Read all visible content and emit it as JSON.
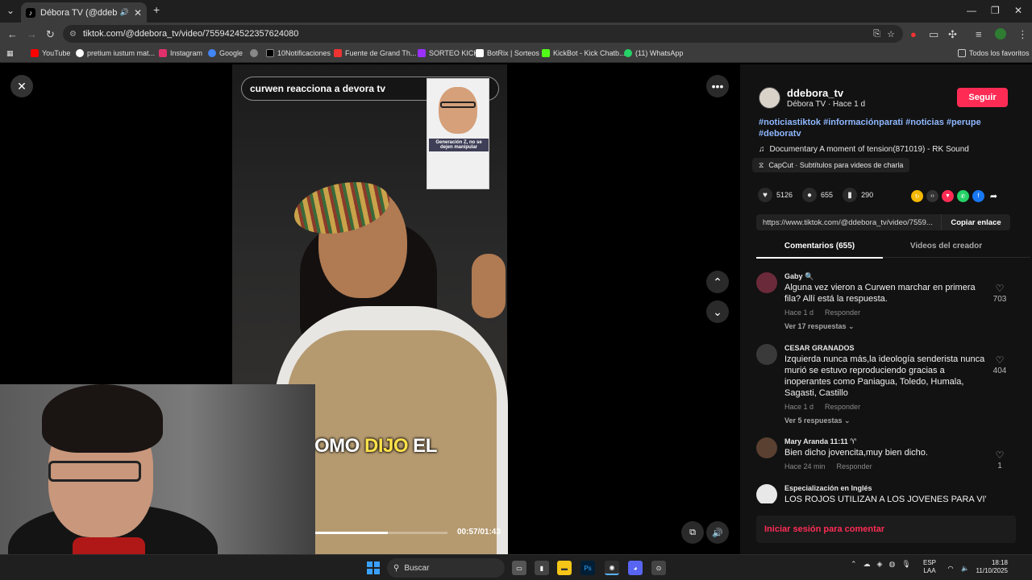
{
  "browser": {
    "tab_title": "Débora TV (@ddebora_tv) |",
    "url": "tiktok.com/@ddebora_tv/video/7559424522357624080",
    "bookmarks": [
      {
        "label": "YouTube",
        "color": "#ff0000"
      },
      {
        "label": "pretium iustum mat...",
        "color": "#ffffff"
      },
      {
        "label": "Instagram",
        "color": "#e1306c"
      },
      {
        "label": "Google",
        "color": "#4285f4"
      },
      {
        "label": "",
        "color": "#888888"
      },
      {
        "label": "10Notificaciones",
        "color": "#000000"
      },
      {
        "label": "Fuente de Grand Th...",
        "color": "#e33"
      },
      {
        "label": "SORTEO KICK",
        "color": "#9b30ff"
      },
      {
        "label": "BotRix | Sorteos",
        "color": "#ffffff"
      },
      {
        "label": "KickBot - Kick Chatb...",
        "color": "#53fc18"
      },
      {
        "label": "(11) WhatsApp",
        "color": "#25d366"
      }
    ],
    "all_bookmarks": "Todos los favoritos"
  },
  "video": {
    "search_text": "curwen reacciona a devora tv",
    "inset_caption": "Generación Z, no se dejen manipular",
    "caption_pre": "OMO ",
    "caption_highlight": "DIJO",
    "caption_post": " EL",
    "timecode": "00:57/01:43",
    "progress": 0.55
  },
  "creator": {
    "username": "ddebora_tv",
    "subline": "Débora TV · Hace 1 d",
    "follow_label": "Seguir",
    "hashtags": "#noticiastiktok #informaciónparati #noticias #perupe #deboratv",
    "music": "Documentary A moment of tension(871019) - RK Sound",
    "capcut": "CapCut · Subtítulos para videos de charla"
  },
  "stats": {
    "likes": "5126",
    "comments": "655",
    "saves": "290"
  },
  "share": {
    "link": "https://www.tiktok.com/@ddebora_tv/video/7559...",
    "copy_label": "Copiar enlace"
  },
  "tabs": {
    "comments": "Comentarios (655)",
    "creator_videos": "Videos del creador"
  },
  "comments": [
    {
      "name": "Gaby 🔍",
      "text": "Alguna vez vieron a Curwen marchar en primera fila? Allí está la respuesta.",
      "time": "Hace 1 d",
      "reply": "Responder",
      "replies": "Ver 17 respuestas ⌄",
      "likes": "703"
    },
    {
      "name": "CESAR GRANADOS",
      "text": "Izquierda nunca más,la ideología senderista nunca murió se estuvo reproduciendo gracias a inoperantes como Paniagua, Toledo, Humala, Sagasti, Castillo",
      "time": "Hace 1 d",
      "reply": "Responder",
      "replies": "Ver 5 respuestas ⌄",
      "likes": "404"
    },
    {
      "name": "Mary Aranda 11:11 ♈",
      "text": "Bien dicho jovencita,muy bien dicho.",
      "time": "Hace 24 min",
      "reply": "Responder",
      "replies": "",
      "likes": "1"
    },
    {
      "name": "Especialización en Inglés",
      "text": "LOS ROJOS UTILIZAN A LOS JOVENES PARA VIVIR",
      "time": "",
      "reply": "",
      "replies": "",
      "likes": ""
    }
  ],
  "login_prompt": "Iniciar sesión para comentar",
  "taskbar": {
    "search_placeholder": "Buscar",
    "lang_top": "ESP",
    "lang_bottom": "LAA",
    "time": "18:18",
    "date": "11/10/2025"
  }
}
